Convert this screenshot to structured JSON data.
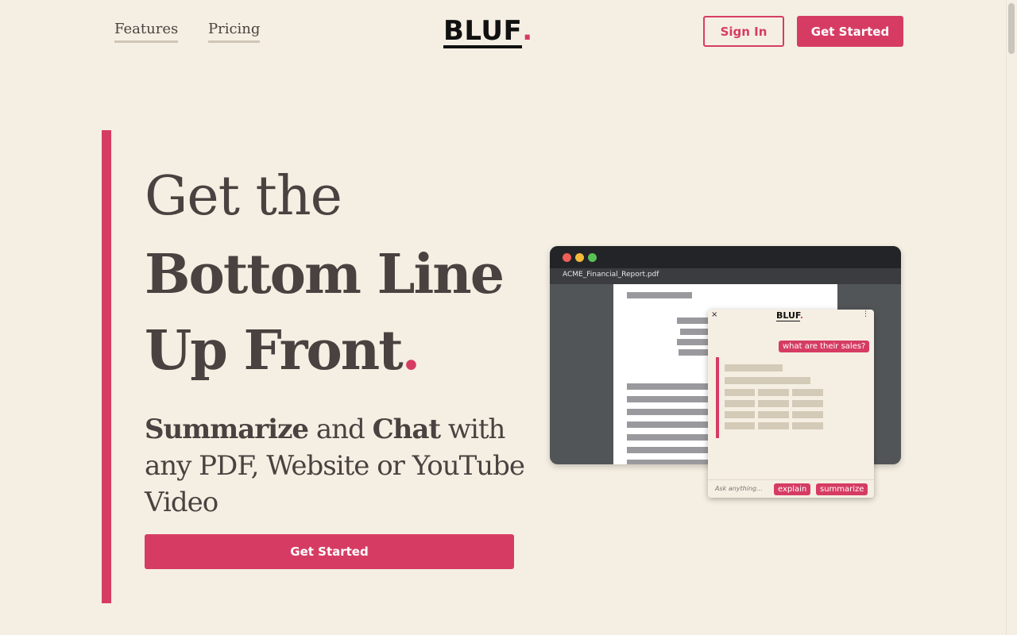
{
  "nav": {
    "links": [
      "Features",
      "Pricing"
    ],
    "logo_text": "BLUF",
    "logo_dot": ".",
    "sign_in": "Sign In",
    "get_started": "Get Started"
  },
  "hero": {
    "line1": "Get the",
    "line2": "Bottom Line",
    "line3": "Up Front",
    "line3_dot": ".",
    "subtitle": {
      "bold1": "Summarize",
      "text1": " and ",
      "bold2": "Chat",
      "text2": " with any PDF, Website or YouTube Video"
    },
    "cta": "Get Started"
  },
  "mockup": {
    "tab_title": "ACME_Financial_Report.pdf",
    "chat": {
      "close": "×",
      "menu": "⋮",
      "logo_text": "BLUF",
      "logo_dot": ".",
      "user_message": "what are their sales?",
      "input_placeholder": "Ask anything...",
      "action_explain": "explain",
      "action_summarize": "summarize"
    }
  },
  "colors": {
    "background": "#f5efe3",
    "accent": "#d63c63",
    "text": "#4a4240"
  }
}
